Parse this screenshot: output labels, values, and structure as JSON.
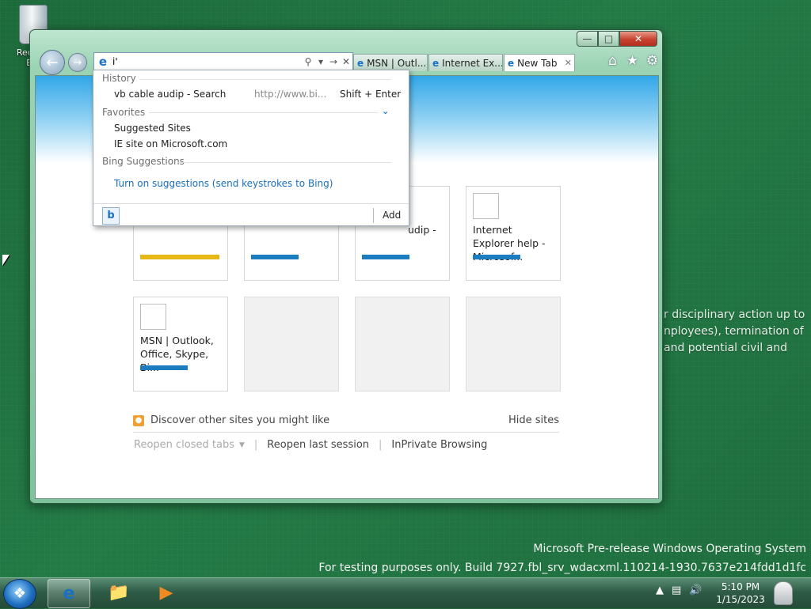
{
  "desktop": {
    "recycle_label": "Recycle Bin",
    "bg_text": [
      "r disciplinary action up to",
      "nployees), termination of",
      "and potential civil and"
    ],
    "watermark_line1": "Microsoft Pre-release Windows Operating System",
    "watermark_line2": "For testing purposes only. Build 7927.fbl_srv_wdacxml.110214-1930.7637e214fdd1d1fc"
  },
  "browser": {
    "address_value": "i'",
    "tabs": [
      {
        "label": "MSN | Outl..."
      },
      {
        "label": "Internet Ex..."
      },
      {
        "label": "New Tab"
      }
    ],
    "tiles": [
      {
        "title": "Internet Explorer help - Microsof...",
        "bar": "blue"
      },
      {
        "title": "MSN | Outlook, Office, Skype, Bi...",
        "bar": "blue"
      },
      {
        "partial_title": "udip -"
      }
    ],
    "discover_label": "Discover other sites you might like",
    "hide_sites": "Hide sites",
    "reopen_closed": "Reopen closed tabs",
    "reopen_last": "Reopen last session",
    "inprivate": "InPrivate Browsing"
  },
  "dropdown": {
    "history_header": "History",
    "history_item": "vb cable audip - Search",
    "history_url": "http://www.bi...",
    "history_shortcut": "Shift + Enter",
    "favorites_header": "Favorites",
    "fav_item1": "Suggested Sites",
    "fav_item2": "IE site on Microsoft.com",
    "bing_header": "Bing Suggestions",
    "bing_link": "Turn on suggestions (send keystrokes to Bing)",
    "add_label": "Add"
  },
  "taskbar": {
    "time": "5:10 PM",
    "date": "1/15/2023"
  }
}
